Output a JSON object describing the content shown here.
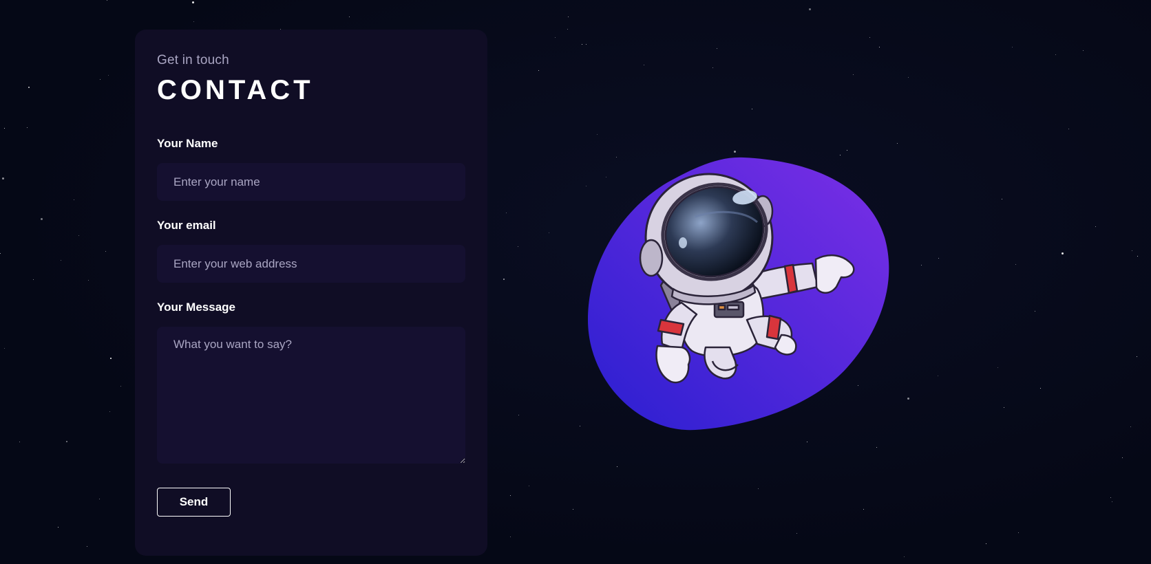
{
  "contact": {
    "eyebrow": "Get in touch",
    "heading": "CONTACT",
    "name_label": "Your Name",
    "name_placeholder": "Enter your name",
    "name_value": "",
    "email_label": "Your email",
    "email_placeholder": "Enter your web address",
    "email_value": "",
    "message_label": "Your Message",
    "message_placeholder": "What you want to say?",
    "message_value": "",
    "send_label": "Send"
  },
  "illustration": {
    "icon": "astronaut-icon",
    "blob_colors": [
      "#2a1fd0",
      "#7b2fe6"
    ]
  },
  "colors": {
    "background": "#050816",
    "card": "#100d25",
    "input": "#151030",
    "secondary_text": "#aaa6c3"
  }
}
